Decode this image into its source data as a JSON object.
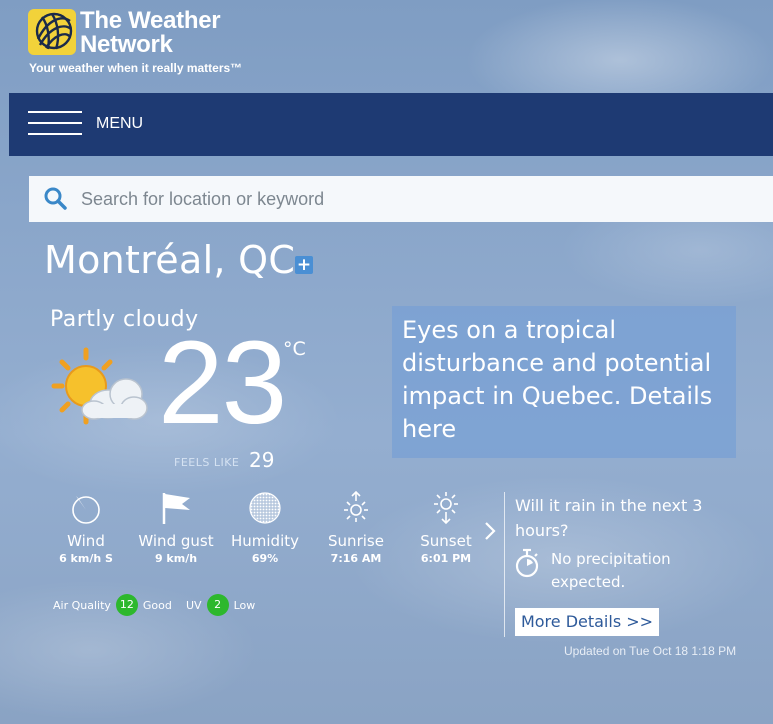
{
  "brand": {
    "name_line1": "The Weather",
    "name_line2": "Network",
    "tagline": "Your weather when it really matters™"
  },
  "nav": {
    "menu_label": "MENU"
  },
  "search": {
    "placeholder": "Search for location or keyword"
  },
  "location": {
    "city": "Montréal, QC",
    "add_favourite_symbol": "+"
  },
  "current": {
    "condition": "Partly cloudy",
    "temperature": "23",
    "unit": "°C",
    "feels_like_label": "FEELS LIKE",
    "feels_like_value": "29",
    "icon": "sun-behind-cloud-icon"
  },
  "alert": {
    "text": "Eyes on a tropical disturbance and potential impact in Quebec. Details here"
  },
  "stats": [
    {
      "icon": "wind-icon",
      "label": "Wind",
      "value": "6 km/h S"
    },
    {
      "icon": "wind-gust-flag-icon",
      "label": "Wind gust",
      "value": "9 km/h"
    },
    {
      "icon": "humidity-icon",
      "label": "Humidity",
      "value": "69%"
    },
    {
      "icon": "sunrise-icon",
      "label": "Sunrise",
      "value": "7:16 AM"
    },
    {
      "icon": "sunset-icon",
      "label": "Sunset",
      "value": "6:01 PM"
    }
  ],
  "air_quality": {
    "label": "Air Quality",
    "value": "12",
    "rating": "Good"
  },
  "uv": {
    "label": "UV",
    "value": "2",
    "rating": "Low"
  },
  "rain": {
    "question": "Will it rain in the next 3 hours?",
    "answer": "No precipitation expected.",
    "button_label": "More Details >>"
  },
  "updated": "Updated on Tue Oct 18 1:18 PM",
  "colors": {
    "nav_background": "#1e3a73",
    "logo_yellow": "#f2d23a",
    "badge_green": "#2db82d",
    "alert_background": "#78a0d4"
  }
}
